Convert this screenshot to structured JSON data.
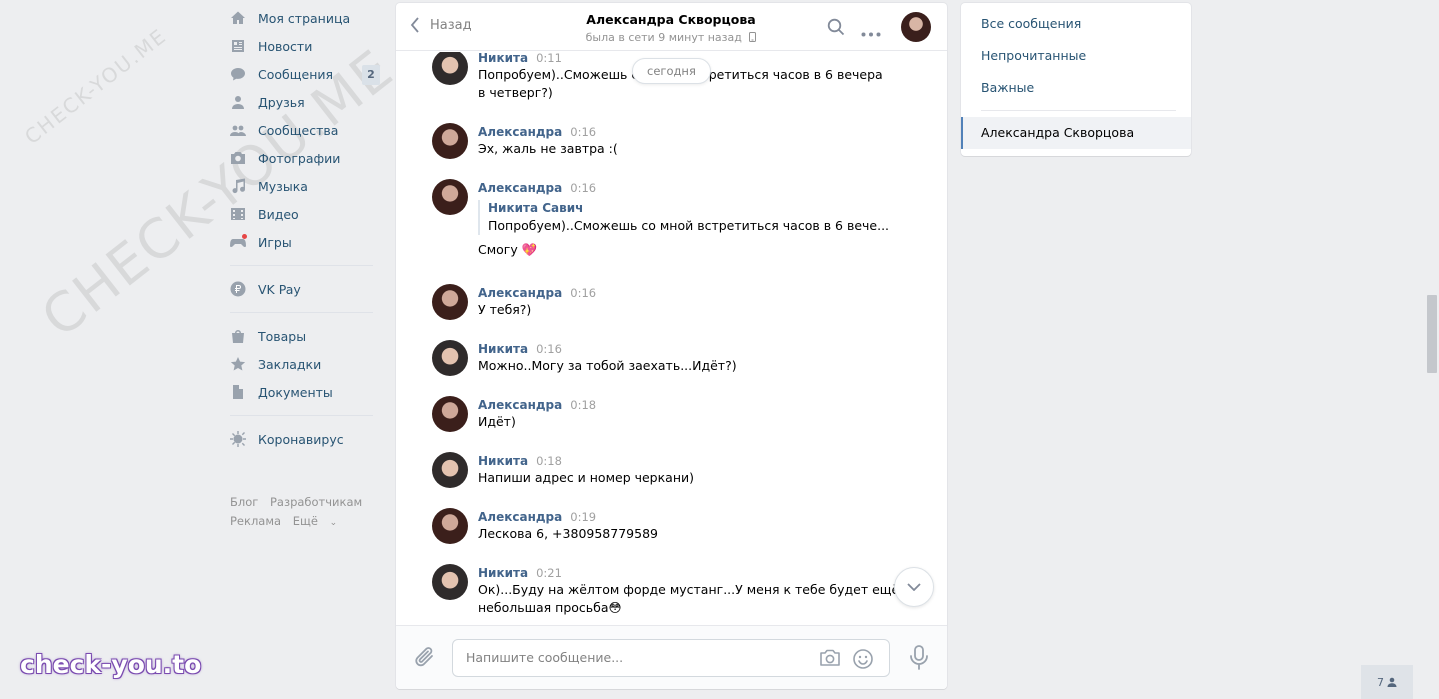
{
  "watermark": {
    "diagonal_big": "CHECK-YOU.ME",
    "diagonal_small": "CHECK-YOU.ME",
    "brand": "check-you.to"
  },
  "left_menu": {
    "items": [
      {
        "label": "Моя страница",
        "icon": "home-icon"
      },
      {
        "label": "Новости",
        "icon": "news-icon"
      },
      {
        "label": "Сообщения",
        "icon": "messages-icon",
        "badge": "2"
      },
      {
        "label": "Друзья",
        "icon": "friends-icon"
      },
      {
        "label": "Сообщества",
        "icon": "communities-icon"
      },
      {
        "label": "Фотографии",
        "icon": "photos-icon"
      },
      {
        "label": "Музыка",
        "icon": "music-icon"
      },
      {
        "label": "Видео",
        "icon": "video-icon"
      },
      {
        "label": "Игры",
        "icon": "games-icon"
      }
    ],
    "vkpay": {
      "label": "VK Pay",
      "icon": "vkpay-icon"
    },
    "items2": [
      {
        "label": "Товары",
        "icon": "shop-icon"
      },
      {
        "label": "Закладки",
        "icon": "bookmark-icon"
      },
      {
        "label": "Документы",
        "icon": "documents-icon"
      }
    ],
    "corona": {
      "label": "Коронавирус",
      "icon": "virus-icon"
    },
    "footer": {
      "blog": "Блог",
      "developers": "Разработчикам",
      "ads": "Реклама",
      "more": "Ещё"
    }
  },
  "chat": {
    "back_label": "Назад",
    "title": "Александра Скворцова",
    "subtitle": "была в сети 9 минут назад",
    "date_pill": "сегодня",
    "messages": [
      {
        "author": "Никита",
        "time": "0:11",
        "lines": [
          "Попробуем)..Сможешь со мной встретиться часов в 6 вечера",
          "в четверг?)"
        ],
        "who": "nik"
      },
      {
        "author": "Александра",
        "time": "0:16",
        "lines": [
          "Эх, жаль не завтра :("
        ],
        "who": "al"
      },
      {
        "author": "Александра",
        "time": "0:16",
        "reply_author": "Никита Савич",
        "reply_text": "Попробуем)..Сможешь со мной встретиться часов в 6 вече...",
        "lines": [
          "Смогу 💖"
        ],
        "who": "al"
      },
      {
        "author": "Александра",
        "time": "0:16",
        "lines": [
          "У тебя?)"
        ],
        "who": "al"
      },
      {
        "author": "Никита",
        "time": "0:16",
        "lines": [
          "Можно..Могу за тобой заехать...Идёт?)"
        ],
        "who": "nik"
      },
      {
        "author": "Александра",
        "time": "0:18",
        "lines": [
          "Идёт)"
        ],
        "who": "al"
      },
      {
        "author": "Никита",
        "time": "0:18",
        "lines": [
          "Напиши адрес и номер черкани)"
        ],
        "who": "nik"
      },
      {
        "author": "Александра",
        "time": "0:19",
        "lines": [
          "Лескова 6, +380958779589"
        ],
        "who": "al"
      },
      {
        "author": "Никита",
        "time": "0:21",
        "lines": [
          "Ок)...Буду на жёлтом форде мустанг...У меня к тебе будет ещё",
          "небольшая просьба😳"
        ],
        "who": "nik"
      }
    ],
    "composer_placeholder": "Напишите сообщение..."
  },
  "right_panel": {
    "all": "Все сообщения",
    "unread": "Непрочитанные",
    "important": "Важные",
    "active_conversation": "Александра Скворцова"
  },
  "online_count": "7",
  "colors": {
    "link": "#285473",
    "author": "#42648b",
    "bg": "#edeef0",
    "accent": "#5181b8"
  }
}
